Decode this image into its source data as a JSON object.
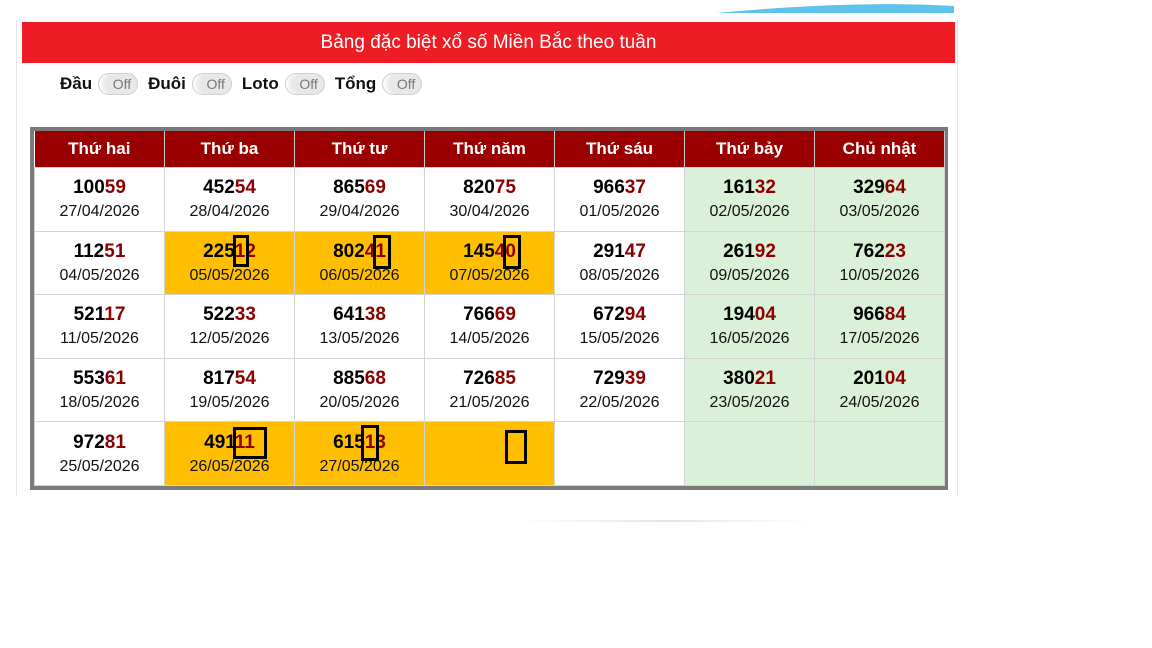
{
  "banner": {
    "title": "Bảng đặc biệt xổ số Miền Bắc theo tuần"
  },
  "filters": [
    {
      "label": "Đầu",
      "state": "Off"
    },
    {
      "label": "Đuôi",
      "state": "Off"
    },
    {
      "label": "Loto",
      "state": "Off"
    },
    {
      "label": "Tổng",
      "state": "Off"
    }
  ],
  "colors": {
    "banner": "#ee1c25",
    "header": "#9b0000",
    "highlight": "#ffbf00",
    "weekend": "#dbf0d8",
    "tail": "#8b0000"
  },
  "table": {
    "headers": [
      "Thứ hai",
      "Thứ ba",
      "Thứ tư",
      "Thứ năm",
      "Thứ sáu",
      "Thứ bảy",
      "Chủ nhật"
    ],
    "rows": [
      [
        {
          "head": "100",
          "tail": "59",
          "date": "27/04/2026"
        },
        {
          "head": "452",
          "tail": "54",
          "date": "28/04/2026"
        },
        {
          "head": "865",
          "tail": "69",
          "date": "29/04/2026"
        },
        {
          "head": "820",
          "tail": "75",
          "date": "30/04/2026"
        },
        {
          "head": "966",
          "tail": "37",
          "date": "01/05/2026"
        },
        {
          "head": "161",
          "tail": "32",
          "date": "02/05/2026"
        },
        {
          "head": "329",
          "tail": "64",
          "date": "03/05/2026"
        }
      ],
      [
        {
          "head": "112",
          "tail": "51",
          "date": "04/05/2026"
        },
        {
          "head": "225",
          "tail": "12",
          "date": "05/05/2026",
          "highlight": true
        },
        {
          "head": "802",
          "tail": "41",
          "date": "06/05/2026",
          "highlight": true
        },
        {
          "head": "145",
          "tail": "40",
          "date": "07/05/2026",
          "highlight": true
        },
        {
          "head": "291",
          "tail": "47",
          "date": "08/05/2026"
        },
        {
          "head": "261",
          "tail": "92",
          "date": "09/05/2026"
        },
        {
          "head": "762",
          "tail": "23",
          "date": "10/05/2026"
        }
      ],
      [
        {
          "head": "521",
          "tail": "17",
          "date": "11/05/2026"
        },
        {
          "head": "522",
          "tail": "33",
          "date": "12/05/2026"
        },
        {
          "head": "641",
          "tail": "38",
          "date": "13/05/2026"
        },
        {
          "head": "766",
          "tail": "69",
          "date": "14/05/2026"
        },
        {
          "head": "672",
          "tail": "94",
          "date": "15/05/2026"
        },
        {
          "head": "194",
          "tail": "04",
          "date": "16/05/2026"
        },
        {
          "head": "966",
          "tail": "84",
          "date": "17/05/2026"
        }
      ],
      [
        {
          "head": "553",
          "tail": "61",
          "date": "18/05/2026"
        },
        {
          "head": "817",
          "tail": "54",
          "date": "19/05/2026"
        },
        {
          "head": "885",
          "tail": "68",
          "date": "20/05/2026"
        },
        {
          "head": "726",
          "tail": "85",
          "date": "21/05/2026"
        },
        {
          "head": "729",
          "tail": "39",
          "date": "22/05/2026"
        },
        {
          "head": "380",
          "tail": "21",
          "date": "23/05/2026"
        },
        {
          "head": "201",
          "tail": "04",
          "date": "24/05/2026"
        }
      ],
      [
        {
          "head": "972",
          "tail": "81",
          "date": "25/05/2026"
        },
        {
          "head": "491",
          "tail": "11",
          "date": "26/05/2026",
          "highlight": true
        },
        {
          "head": "615",
          "tail": "13",
          "date": "27/05/2026",
          "highlight": true
        },
        {
          "head": "",
          "tail": "",
          "date": "",
          "highlight": true
        },
        {
          "head": "",
          "tail": "",
          "date": ""
        },
        {
          "head": "",
          "tail": "",
          "date": ""
        },
        {
          "head": "",
          "tail": "",
          "date": ""
        }
      ]
    ]
  }
}
